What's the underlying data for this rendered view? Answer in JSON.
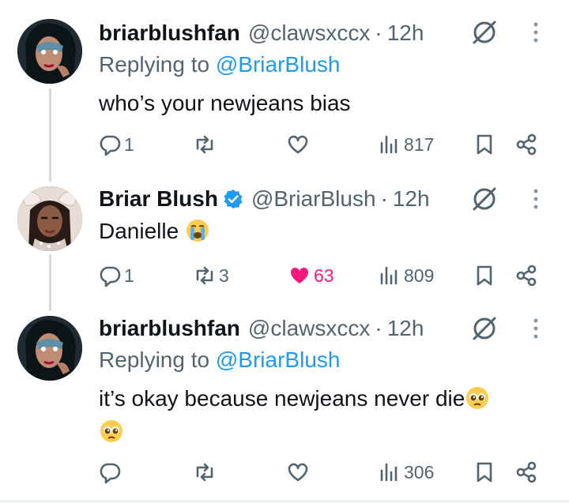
{
  "tweets": [
    {
      "name": "briarblushfan",
      "handle": "@clawsxccx",
      "dot": "·",
      "time": "12h",
      "replying_prefix": "Replying to ",
      "replying_handle": "@BriarBlush",
      "text": "who’s your newjeans bias",
      "replies": "1",
      "retweets": "",
      "likes": "",
      "views": "817"
    },
    {
      "name": "Briar Blush",
      "handle": "@BriarBlush",
      "dot": "·",
      "time": "12h",
      "verified": true,
      "text": "Danielle",
      "text_emoji": "loudly-crying-face",
      "replies": "1",
      "retweets": "3",
      "likes": "63",
      "views": "809"
    },
    {
      "name": "briarblushfan",
      "handle": "@clawsxccx",
      "dot": "·",
      "time": "12h",
      "replying_prefix": "Replying to ",
      "replying_handle": "@BriarBlush",
      "text": "it’s okay because newjeans never die",
      "text_emoji": "pleading-face",
      "replies": "",
      "retweets": "",
      "likes": "",
      "views": "306"
    }
  ],
  "colors": {
    "text": "#0f1419",
    "muted": "#536471",
    "link": "#1d9bf0",
    "like": "#f91880",
    "verified": "#1d9bf0",
    "thread_line": "#cfd9de"
  }
}
